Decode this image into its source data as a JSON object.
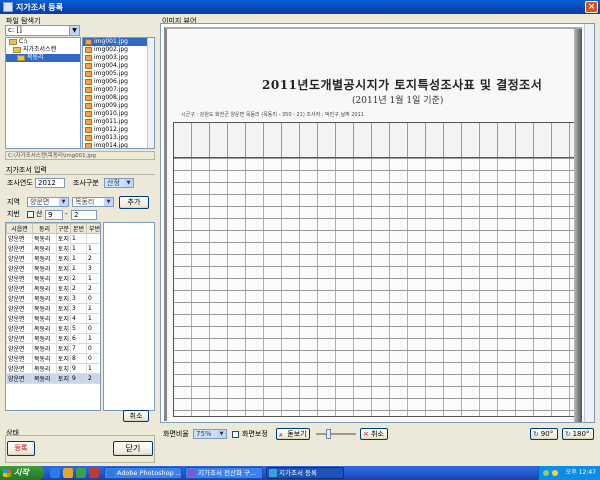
{
  "window": {
    "title": "지가조서 등록"
  },
  "file_explorer": {
    "title": "파일 탐색기",
    "drive": "c: []",
    "folders": [
      {
        "label": "C:\\",
        "selected": false
      },
      {
        "label": "지가조서스캔",
        "selected": false
      },
      {
        "label": "목동리",
        "selected": true
      }
    ],
    "files": [
      {
        "label": "img001.jpg",
        "selected": true
      },
      {
        "label": "img002.jpg",
        "selected": false
      },
      {
        "label": "img003.jpg",
        "selected": false
      },
      {
        "label": "img004.jpg",
        "selected": false
      },
      {
        "label": "img005.jpg",
        "selected": false
      },
      {
        "label": "img006.jpg",
        "selected": false
      },
      {
        "label": "img007.jpg",
        "selected": false
      },
      {
        "label": "img008.jpg",
        "selected": false
      },
      {
        "label": "img009.jpg",
        "selected": false
      },
      {
        "label": "img010.jpg",
        "selected": false
      },
      {
        "label": "img011.jpg",
        "selected": false
      },
      {
        "label": "img012.jpg",
        "selected": false
      },
      {
        "label": "img013.jpg",
        "selected": false
      },
      {
        "label": "img014.jpg",
        "selected": false
      }
    ],
    "path": "C:\\지가조서스캔\\목동리\\img001.jpg"
  },
  "input_panel": {
    "title": "지가조서 입력",
    "year_label": "조사연도",
    "year_value": "2012",
    "type_label": "조사구분",
    "type_value": "산정",
    "region_label": "지역",
    "region_value": "양운면",
    "village_value": "목동리",
    "add_button": "추가",
    "lot_label": "지번",
    "mountain_label": "산",
    "lot_main": "9",
    "lot_sub": "2",
    "columns": [
      "시읍면",
      "동리",
      "구분",
      "본번",
      "부번"
    ],
    "rows": [
      [
        "양운면",
        "목동리",
        "토지",
        "1",
        ""
      ],
      [
        "양운면",
        "목동리",
        "토지",
        "1",
        "1"
      ],
      [
        "양운면",
        "목동리",
        "토지",
        "1",
        "2"
      ],
      [
        "양운면",
        "목동리",
        "토지",
        "1",
        "3"
      ],
      [
        "양운면",
        "목동리",
        "토지",
        "2",
        "1"
      ],
      [
        "양운면",
        "목동리",
        "토지",
        "2",
        "2"
      ],
      [
        "양운면",
        "목동리",
        "토지",
        "3",
        "0"
      ],
      [
        "양운면",
        "목동리",
        "토지",
        "3",
        "1"
      ],
      [
        "양운면",
        "목동리",
        "토지",
        "4",
        "1"
      ],
      [
        "양운면",
        "목동리",
        "토지",
        "5",
        "0"
      ],
      [
        "양운면",
        "목동리",
        "토지",
        "6",
        "1"
      ],
      [
        "양운면",
        "목동리",
        "토지",
        "7",
        "0"
      ],
      [
        "양운면",
        "목동리",
        "토지",
        "8",
        "0"
      ],
      [
        "양운면",
        "목동리",
        "토지",
        "9",
        "1"
      ],
      [
        "양운면",
        "목동리",
        "토지",
        "9",
        "2"
      ]
    ],
    "selected_row": 14,
    "cancel_button": "취소"
  },
  "status": {
    "title": "상태"
  },
  "actions": {
    "register": "등록",
    "close": "닫기"
  },
  "viewer": {
    "title": "이미지 뷰어",
    "doc_title": "2011년도개별공시지가 토지특성조사표 및 결정조서",
    "doc_subtitle": "(2011년 1월 1일 기준)",
    "doc_meta": "시군구 : 강원도 화천군 양운면 목동리   (목동리 - 350 - 21)   조사자 : 박민구     날짜 2011",
    "zoom_label": "화면비율",
    "zoom_value": "75%",
    "invert_label": "화면보정",
    "magnifier_button": "돋보기",
    "cancel_button": "취소",
    "rotate_90": "90°",
    "rotate_180": "180°"
  },
  "taskbar": {
    "start": "시작",
    "tasks": [
      {
        "label": "Adobe Photoshop ...",
        "active": false
      },
      {
        "label": "지가조서 전산화 구...",
        "active": false
      },
      {
        "label": "지가조서 등록",
        "active": true
      }
    ],
    "clock": "오후 12:47"
  },
  "colors": {
    "titlebar": "#0a5fd6",
    "selection": "#316ac5",
    "register_text": "#c00000",
    "taskbar": "#245edb"
  }
}
